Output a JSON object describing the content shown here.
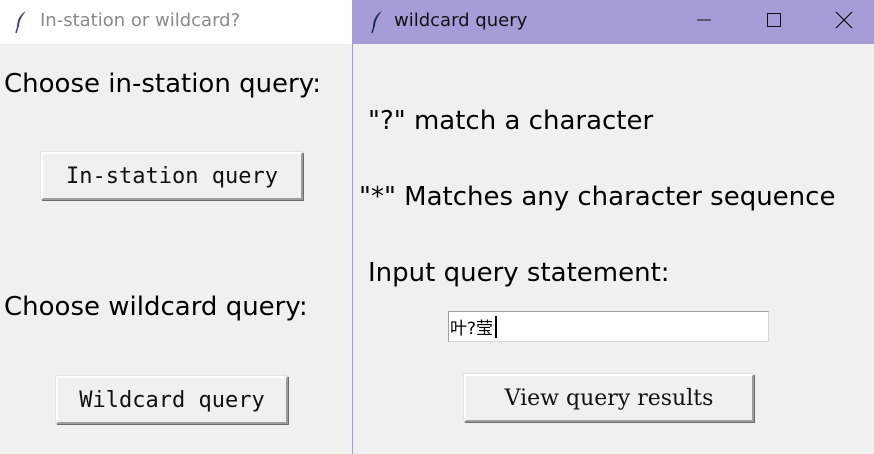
{
  "back_window": {
    "title": "In-station or wildcard?",
    "in_station_prompt": "Choose in-station query:",
    "in_station_button": "In-station query",
    "wildcard_prompt": "Choose wildcard query:",
    "wildcard_button": "Wildcard query"
  },
  "front_window": {
    "title": "wildcard query",
    "titlebar_color": "#a59cd8",
    "hint_question_mark": "\"?\" match a character",
    "hint_asterisk": "\"*\" Matches any character sequence",
    "input_label": "Input query statement:",
    "query_input_value": "叶?莹",
    "view_results_button": "View query results",
    "controls": [
      "minimize-icon",
      "maximize-icon",
      "close-icon"
    ]
  }
}
